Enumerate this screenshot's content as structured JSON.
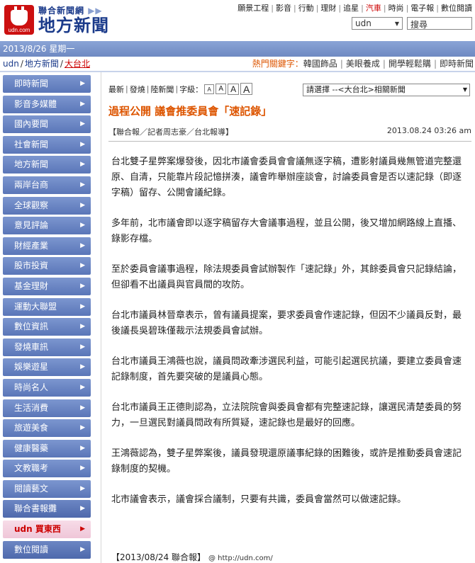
{
  "header": {
    "logo_top": "聯合新聞網",
    "logo_arrows": "▶▶",
    "logo_main": "地方新聞",
    "logo_sub": "udn.com",
    "nav": [
      "願景工程",
      "影音",
      "行動",
      "理財",
      "追星",
      "汽車",
      "時尚",
      "電子報",
      "數位閱讀"
    ],
    "nav_hot": "汽車",
    "site_select": "udn",
    "search_label": "搜尋"
  },
  "datebar": {
    "text": "2013/8/26 星期一"
  },
  "breadcrumb": {
    "items": [
      "udn",
      "地方新聞",
      "大台北"
    ]
  },
  "hotwords": {
    "label": "熱門關鍵字：",
    "items": [
      "韓國飾品",
      "美眼養成",
      "開學輕鬆購",
      "即時新聞"
    ]
  },
  "sidebar": {
    "items": [
      "即時新聞",
      "影音多媒體",
      "國內要聞",
      "社會新聞",
      "地方新聞",
      "兩岸台商",
      "全球觀察",
      "意見評論",
      "財經產業",
      "股市投資",
      "基金理財",
      "運動大聯盟",
      "數位資訊",
      "發燒車訊",
      "娛樂遊星",
      "時尚名人",
      "生活消費",
      "旅遊美食",
      "健康醫藥",
      "文教職考",
      "閱讀藝文",
      "聯合書報攤",
      "udn 買東西",
      "數位閱讀"
    ]
  },
  "toolbar": {
    "newest": "最新",
    "sent": "發燒",
    "local": "陸新聞",
    "font_label": "字級：",
    "font_a": "A",
    "related_select": "請選擇 --<大台北>相關新聞"
  },
  "article": {
    "title": "過程公開 議會推委員會「速記錄」",
    "byline": "【聯合報／記者周志豪／台北報導】",
    "date": "2013.08.24 03:26 am",
    "paragraphs": [
      "台北雙子星弊案爆發後，因北市議會委員會會議無逐字稿，遭影射議員幾無管道完整還原、自清，只能靠片段記憶拼湊，議會昨舉辦座談會，討論委員會是否以速記錄（即逐字稿）留存、公開會議紀錄。",
      "多年前，北市議會即以逐字稿留存大會議事過程，並且公開，後又增加網路線上直播、錄影存檔。",
      "至於委員會議事過程，除法規委員會試辦製作「速記錄」外，其餘委員會只記錄結論，但卻看不出議員與官員間的攻防。",
      "台北市議員林晉章表示，曾有議員提案，要求委員會作速記錄，但因不少議員反對，最後議長吳碧珠僅裁示法規委員會試辦。",
      "台北市議員王鴻薇也說，議員問政牽涉選民利益，可能引起選民抗議，要建立委員會速記錄制度，首先要突破的是議員心態。",
      "台北市議員王正德則認為，立法院院會與委員會都有完整速記錄，讓選民清楚委員的努力，一旦選民對議員問政有所質疑，速記錄也是最好的回應。",
      "王鴻薇認為，雙子星弊案後，議員發現還原議事紀錄的困難後，或許是推動委員會速記錄制度的契機。",
      "北市議會表示，議會採合議制，只要有共識，委員會當然可以做速記錄。"
    ],
    "source": "【2013/08/24 聯合報】",
    "source_url": "@ http://udn.com/"
  }
}
